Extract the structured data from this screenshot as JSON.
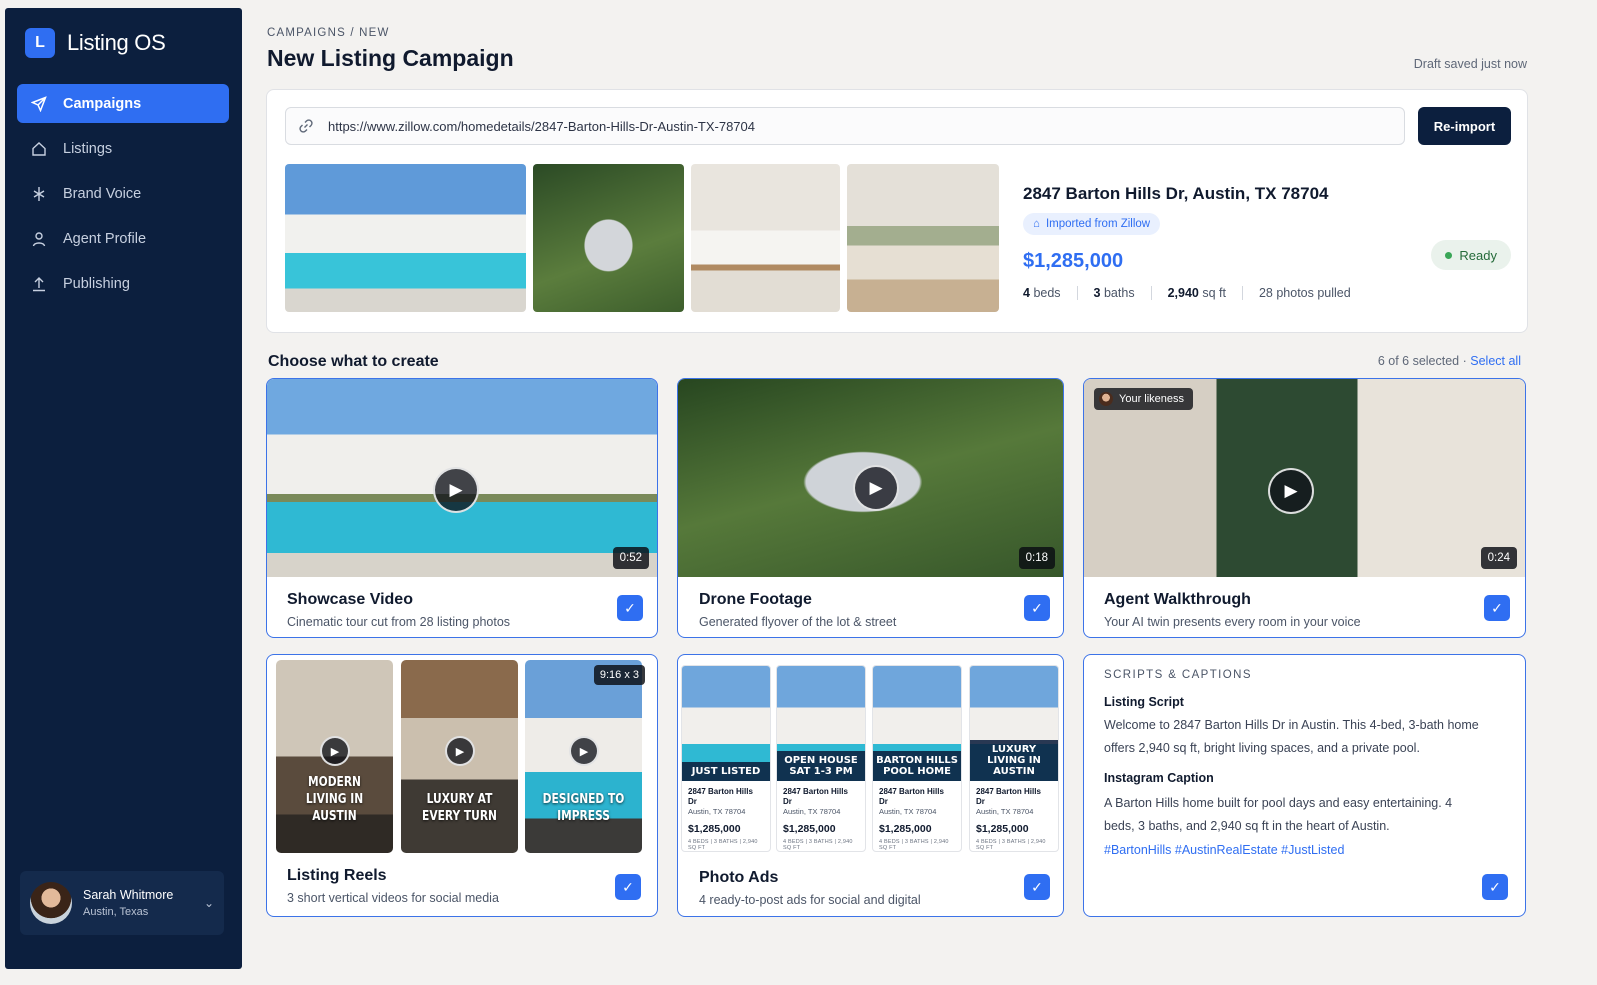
{
  "app": {
    "logo_letter": "L",
    "name": "Listing OS",
    "accent": "#2f6ef2",
    "sidebar_bg": "#0c1f3e"
  },
  "sidebar": {
    "items": [
      {
        "label": "Campaigns",
        "icon": "send-icon",
        "active": true
      },
      {
        "label": "Listings",
        "icon": "home-icon",
        "active": false
      },
      {
        "label": "Brand Voice",
        "icon": "sparkle-icon",
        "active": false
      },
      {
        "label": "Agent Profile",
        "icon": "user-icon",
        "active": false
      },
      {
        "label": "Publishing",
        "icon": "upload-icon",
        "active": false
      }
    ],
    "user": {
      "name": "Sarah Whitmore",
      "location": "Austin, Texas"
    }
  },
  "header": {
    "breadcrumb": "CAMPAIGNS / NEW",
    "title": "New Listing Campaign",
    "draft_status": "Draft saved just now"
  },
  "import": {
    "url": "https://www.zillow.com/homedetails/2847-Barton-Hills-Dr-Austin-TX-78704",
    "reimport_label": "Re-import",
    "address": "2847 Barton Hills Dr, Austin, TX 78704",
    "source_badge": "Imported from Zillow",
    "price": "$1,285,000",
    "beds_num": "4",
    "beds_unit": "beds",
    "baths_num": "3",
    "baths_unit": "baths",
    "sqft_num": "2,940",
    "sqft_unit": "sq ft",
    "photos": "28 photos pulled",
    "status": "Ready"
  },
  "create": {
    "heading": "Choose what to create",
    "selected": "6 of 6 selected ·",
    "select_all": "Select all",
    "cards": {
      "showcase": {
        "title": "Showcase Video",
        "subtitle": "Cinematic tour cut from 28 listing photos",
        "duration": "0:52"
      },
      "drone": {
        "title": "Drone Footage",
        "subtitle": "Generated flyover of the lot & street",
        "duration": "0:18"
      },
      "agent": {
        "title": "Agent Walkthrough",
        "subtitle": "Your AI twin presents every room in your voice",
        "duration": "0:24",
        "badge": "Your likeness"
      },
      "reels": {
        "title": "Listing Reels",
        "subtitle": "3 short vertical videos for social media",
        "ratio": "9:16 x 3",
        "captions": [
          "Modern living in Austin",
          "Luxury at every turn",
          "Designed to impress"
        ]
      },
      "ads": {
        "title": "Photo Ads",
        "subtitle": "4 ready-to-post ads for social and digital",
        "banners": [
          "Just listed",
          "Open house sat 1-3 pm",
          "Barton Hills pool home",
          "Luxury living in Austin"
        ],
        "ad_address": "2847 Barton Hills Dr",
        "ad_city": "Austin, TX 78704",
        "ad_price": "$1,285,000",
        "ad_meta": "4 BEDS | 3 BATHS | 2,940 SQ FT"
      },
      "scripts": {
        "label": "SCRIPTS & CAPTIONS",
        "listing_script_title": "Listing Script",
        "listing_script": "Welcome to 2847 Barton Hills Dr in Austin. This 4-bed, 3-bath home offers 2,940 sq ft, bright living spaces, and a private pool.",
        "instagram_title": "Instagram Caption",
        "instagram_caption": "A Barton Hills home built for pool days and easy entertaining. 4 beds, 3 baths, and 2,940 sq ft in the heart of Austin.",
        "hashtags": "#BartonHills #AustinRealEstate #JustListed"
      }
    }
  }
}
